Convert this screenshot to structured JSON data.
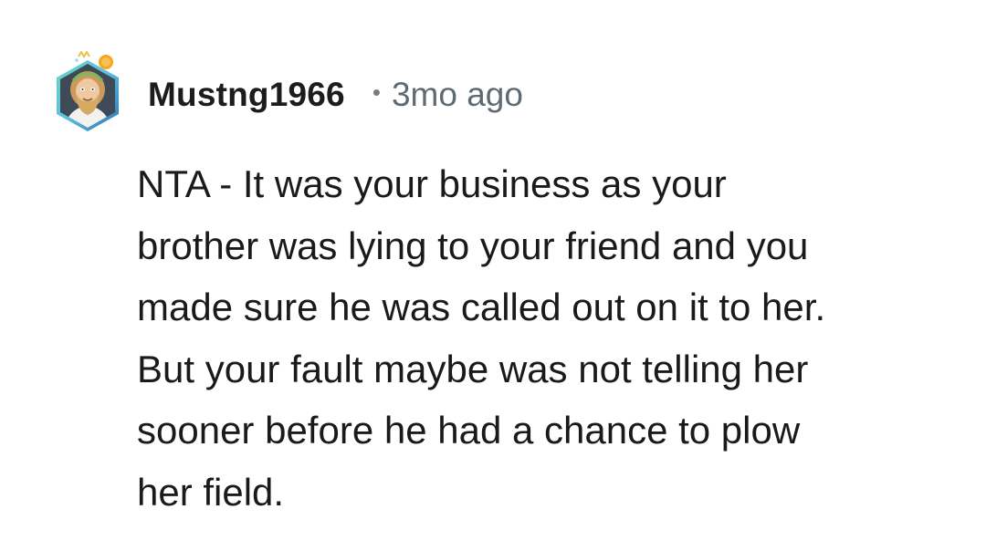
{
  "comment": {
    "author": "Mustng1966",
    "separator": "•",
    "timestamp": "3mo ago",
    "avatar_icon": "bearded-man-avatar-icon",
    "body_lines": [
      "NTA - It was your business as your",
      "brother was lying to your friend and you",
      "made sure he was called out on it to her.",
      "But your fault maybe was not telling her",
      "sooner before he had a chance to plow",
      "her field."
    ]
  },
  "colors": {
    "text": "#1a1a1b",
    "meta": "#5f6b73",
    "avatar_ring_start": "#5bc0de",
    "avatar_ring_end": "#2f6fb5",
    "avatar_badge": "#f5a623"
  }
}
